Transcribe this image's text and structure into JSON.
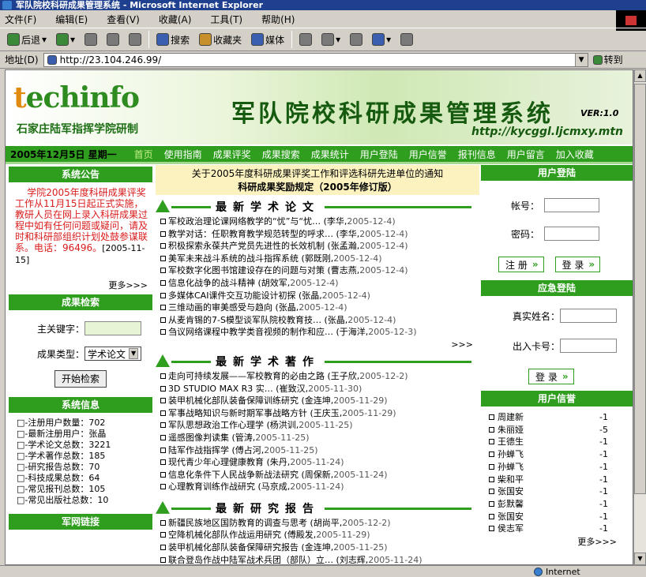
{
  "window": {
    "title": "军队院校科研成果管理系统 - Microsoft Internet Explorer"
  },
  "menubar": [
    "文件(F)",
    "编辑(E)",
    "查看(V)",
    "收藏(A)",
    "工具(T)",
    "帮助(H)"
  ],
  "toolbar": {
    "back": "后退",
    "search": "搜索",
    "favorites": "收藏夹",
    "media": "媒体"
  },
  "address": {
    "label": "地址(D)",
    "url": "http://23.104.246.99/",
    "go": "转到"
  },
  "status": {
    "zone": "Internet"
  },
  "site": {
    "logo": "techinfo",
    "logo_sub": "石家庄陆军指挥学院研制",
    "title": "军队院校科研成果管理系统",
    "version": "VER:1.0",
    "url": "http://kycggl.ljcmxy.mtn"
  },
  "nav": {
    "date": "2005年12月5日  星期一",
    "items": [
      "首页",
      "使用指南",
      "成果评奖",
      "成果搜索",
      "成果统计",
      "用户登陆",
      "用户信誉",
      "报刊信息",
      "用户留言",
      "加入收藏"
    ]
  },
  "announcement": {
    "title": "系统公告",
    "text": "学院2005年度科研成果评奖工作从11月15日起正式实施，教研人员在网上录入科研成果过程中如有任何问题或疑问，请及时和科研部组织计划处鼓参谋联系。电话：96496。",
    "date": "[2005-11-15]",
    "more": "更多>>>"
  },
  "search": {
    "title": "成果检索",
    "keyword_label": "主关键字：",
    "type_label": "成果类型：",
    "type_value": "学术论文",
    "button": "开始检索"
  },
  "sysinfo": {
    "title": "系统信息",
    "items": [
      "□-注册用户数量：702",
      "□-最新注册用户：张晶",
      "□-学术论文总数：3221",
      "□-学术著作总数：185",
      "□-研究报告总数：70",
      "□-科技成果总数：64",
      "□-常见报刊总数：105",
      "□-常见出版社总数：10"
    ]
  },
  "links": {
    "title": "军网链接"
  },
  "top_notice": {
    "line1": "关于2005年度科研成果评奖工作和评选科研先进单位的通知",
    "line2": "科研成果奖励规定（2005年修订版）"
  },
  "papers": {
    "title": "最新学术论文",
    "items": [
      {
        "t": "军校政治理论课网络教学的“忧”与“忧…",
        "a": "(李华,",
        "d": "2005-12-4)"
      },
      {
        "t": "教学对话：任职教育教学规范转型的呼求…",
        "a": "(李华,",
        "d": "2005-12-4)"
      },
      {
        "t": "积极探索永葆共产党员先进性的长效机制",
        "a": "(张孟瀚,",
        "d": "2005-12-4)"
      },
      {
        "t": "美军未来战斗系统的战斗指挥系统",
        "a": "(郭既刚,",
        "d": "2005-12-4)"
      },
      {
        "t": "军校数字化图书馆建设存在的问题与对策",
        "a": "(曹志燕,",
        "d": "2005-12-4)"
      },
      {
        "t": "信息化战争的战斗精神",
        "a": "(胡效军,",
        "d": "2005-12-4)"
      },
      {
        "t": "多媒体CAI课件交互功能设计初探",
        "a": "(张晶,",
        "d": "2005-12-4)"
      },
      {
        "t": "三维动画的审美感受与趋向",
        "a": "(张晶,",
        "d": "2005-12-4)"
      },
      {
        "t": "从麦肯锡的7-S模型谈军队院校教育技…",
        "a": "(张晶,",
        "d": "2005-12-4)"
      },
      {
        "t": "刍议网络课程中教学类音视频的制作和应…",
        "a": "(于海洋,",
        "d": "2005-12-3)"
      }
    ],
    "more": ">>>"
  },
  "books": {
    "title": "最新学术著作",
    "items": [
      {
        "t": "走向可持续发展——军校教育的必由之路",
        "a": "(王子欣,",
        "d": "2005-12-2)"
      },
      {
        "t": "3D STUDIO MAX R3 实…",
        "a": "(崔致汉,",
        "d": "2005-11-30)"
      },
      {
        "t": "装甲机械化部队装备保障训练研究",
        "a": "(金连坤,",
        "d": "2005-11-29)"
      },
      {
        "t": "军事战略知识与新时期军事战略方针",
        "a": "(王庆玉,",
        "d": "2005-11-29)"
      },
      {
        "t": "军队思想政治工作心理学",
        "a": "(杨洪训,",
        "d": "2005-11-25)"
      },
      {
        "t": "遥感图像判读集",
        "a": "(管涛,",
        "d": "2005-11-25)"
      },
      {
        "t": "陆军作战指挥学",
        "a": "(傅占河,",
        "d": "2005-11-25)"
      },
      {
        "t": "现代青少年心理健康教育",
        "a": "(朱丹,",
        "d": "2005-11-24)"
      },
      {
        "t": "信息化条件下人民战争新战法研究",
        "a": "(周保新,",
        "d": "2005-11-24)"
      },
      {
        "t": "心理教育训练作战研究",
        "a": "(马京成,",
        "d": "2005-11-24)"
      }
    ]
  },
  "reports": {
    "title": "最新研究报告",
    "items": [
      {
        "t": "新疆民族地区国防教育的调查与思考",
        "a": "(胡尚平,",
        "d": "2005-12-2)"
      },
      {
        "t": "空降机械化部队作战运用研究",
        "a": "(傅殿发,",
        "d": "2005-11-29)"
      },
      {
        "t": "装甲机械化部队装备保障研究报告",
        "a": "(金连坤,",
        "d": "2005-11-25)"
      },
      {
        "t": "联合登岛作战中陆军战术兵团（部队）立…",
        "a": "(刘志辉,",
        "d": "2005-11-24)"
      }
    ]
  },
  "user_login": {
    "title": "用户登陆",
    "account_label": "帐号：",
    "password_label": "密码：",
    "register": "注 册",
    "login": "登 录"
  },
  "emergency_login": {
    "title": "应急登陆",
    "name_label": "真实姓名：",
    "card_label": "出入卡号：",
    "login": "登 录"
  },
  "credit": {
    "title": "用户信誉",
    "items": [
      {
        "n": "周建新",
        "v": "-1"
      },
      {
        "n": "朱丽娅",
        "v": "-5"
      },
      {
        "n": "王德生",
        "v": "-1"
      },
      {
        "n": "孙蝉飞",
        "v": "-1"
      },
      {
        "n": "孙蝉飞",
        "v": "-1"
      },
      {
        "n": "柴和平",
        "v": "-1"
      },
      {
        "n": "张国安",
        "v": "-1"
      },
      {
        "n": "彭默馨",
        "v": "-1"
      },
      {
        "n": "张国安",
        "v": "-1"
      },
      {
        "n": "侯志军",
        "v": "-1"
      }
    ],
    "more": "更多>>>"
  }
}
